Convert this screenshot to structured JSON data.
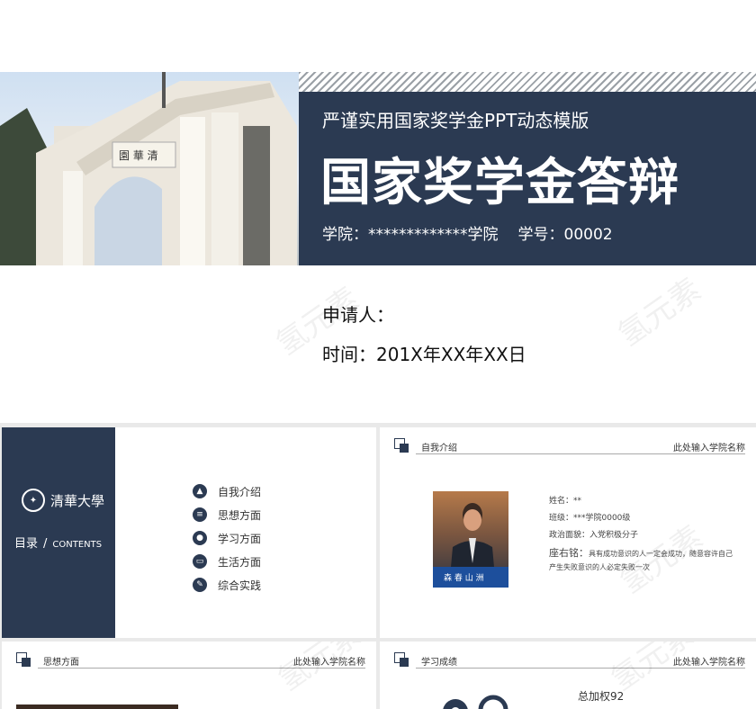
{
  "hero": {
    "subtitle": "严谨实用国家奖学金PPT动态模版",
    "title": "国家奖学金答辩",
    "college": "学院：*************学院",
    "student_no": "学号：00002",
    "applicant": "申请人：",
    "time": "时间：201X年XX年XX日",
    "panel_color": "#2b3a52"
  },
  "watermark": "氢元素",
  "toc": {
    "logo_text": "清華大學",
    "label_cn": "目录",
    "label_sep": "/",
    "label_en": "CONTENTS",
    "items": [
      {
        "label": "自我介绍",
        "icon": "graduation-cap-icon"
      },
      {
        "label": "思想方面",
        "icon": "book-icon"
      },
      {
        "label": "学习方面",
        "icon": "person-icon"
      },
      {
        "label": "生活方面",
        "icon": "monitor-icon"
      },
      {
        "label": "综合实践",
        "icon": "pen-icon"
      }
    ]
  },
  "intro": {
    "section_title": "自我介绍",
    "right_label": "此处输入学院名称",
    "name": "姓名：**",
    "class": "班级：***学院0000级",
    "politics": "政治面貌：入党积极分子",
    "motto_key": "座右铭：",
    "motto_text": "具有成功意识的人一定会成功，随意容许自己产生失败意识的人必定失败一次"
  },
  "thought": {
    "section_title": "思想方面",
    "right_label": "此处输入学院名称"
  },
  "study": {
    "section_title": "学习成绩",
    "right_label": "此处输入学院名称",
    "score": "总加权92"
  }
}
